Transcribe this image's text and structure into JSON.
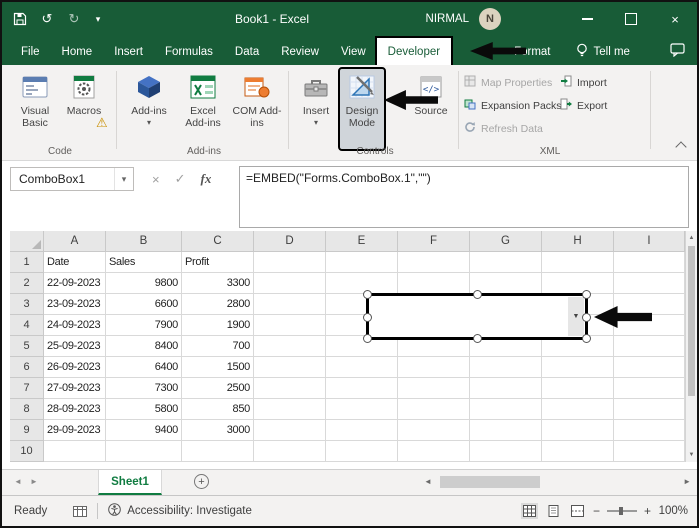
{
  "colors": {
    "title_green": "#185C37",
    "accent_green": "#107C41",
    "ribbon_bg": "#F3F2F1",
    "annotation_black": "#0A0A0A"
  },
  "titlebar": {
    "title": "Book1 - Excel",
    "user_name": "NIRMAL",
    "avatar_initial": "N"
  },
  "tabs": {
    "items": [
      "File",
      "Home",
      "Insert",
      "Formulas",
      "Data",
      "Review",
      "View",
      "Developer",
      "Format"
    ],
    "active": "Developer",
    "tell_me_label": "Tell me"
  },
  "ribbon": {
    "code_group": {
      "label": "Code",
      "visual_basic": "Visual Basic",
      "macros": "Macros"
    },
    "addins_group": {
      "label": "Add-ins",
      "add_ins": "Add-ins",
      "excel_add_ins": "Excel Add-ins",
      "com_add_ins": "COM Add-ins"
    },
    "controls_group": {
      "label": "Controls",
      "insert": "Insert",
      "design_mode": "Design Mode",
      "source": "Source"
    },
    "xml_group": {
      "label": "XML",
      "map_properties": "Map Properties",
      "expansion_packs": "Expansion Packs",
      "refresh_data": "Refresh Data",
      "import": "Import",
      "export": "Export"
    }
  },
  "formula_bar": {
    "name_box_value": "ComboBox1",
    "cancel_label": "×",
    "enter_label": "✓",
    "fx_label": "fx",
    "formula": "=EMBED(\"Forms.ComboBox.1\",\"\")"
  },
  "grid": {
    "col_headers": [
      "A",
      "B",
      "C",
      "D",
      "E",
      "F",
      "G",
      "H",
      "I"
    ],
    "row_headers": [
      "1",
      "2",
      "3",
      "4",
      "5",
      "6",
      "7",
      "8",
      "9",
      "10"
    ],
    "rows": [
      [
        "Date",
        "Sales",
        "Profit"
      ],
      [
        "22-09-2023",
        9800,
        3300
      ],
      [
        "23-09-2023",
        6600,
        2800
      ],
      [
        "24-09-2023",
        7900,
        1900
      ],
      [
        "25-09-2023",
        8400,
        700
      ],
      [
        "26-09-2023",
        6400,
        1500
      ],
      [
        "27-09-2023",
        7300,
        2500
      ],
      [
        "28-09-2023",
        5800,
        850
      ],
      [
        "29-09-2023",
        9400,
        3000
      ],
      []
    ]
  },
  "sheet_bar": {
    "active_tab": "Sheet1"
  },
  "status_bar": {
    "ready_label": "Ready",
    "accessibility_label": "Accessibility: Investigate",
    "zoom_value": "100%"
  },
  "icons": {
    "undo": "↺",
    "redo": "↻",
    "qat_dropdown": "▾",
    "name_box_dropdown": "▾",
    "combobox_dropdown": "▼",
    "close": "×",
    "sheet_nav_left": "◄",
    "sheet_nav_right": "►",
    "hscroll_left": "◄",
    "hscroll_right": "►",
    "vscroll_up": "▲",
    "vscroll_down": "▼",
    "warning": "⚠",
    "new_sheet": "+",
    "zoom_out": "−",
    "zoom_in": "+"
  }
}
